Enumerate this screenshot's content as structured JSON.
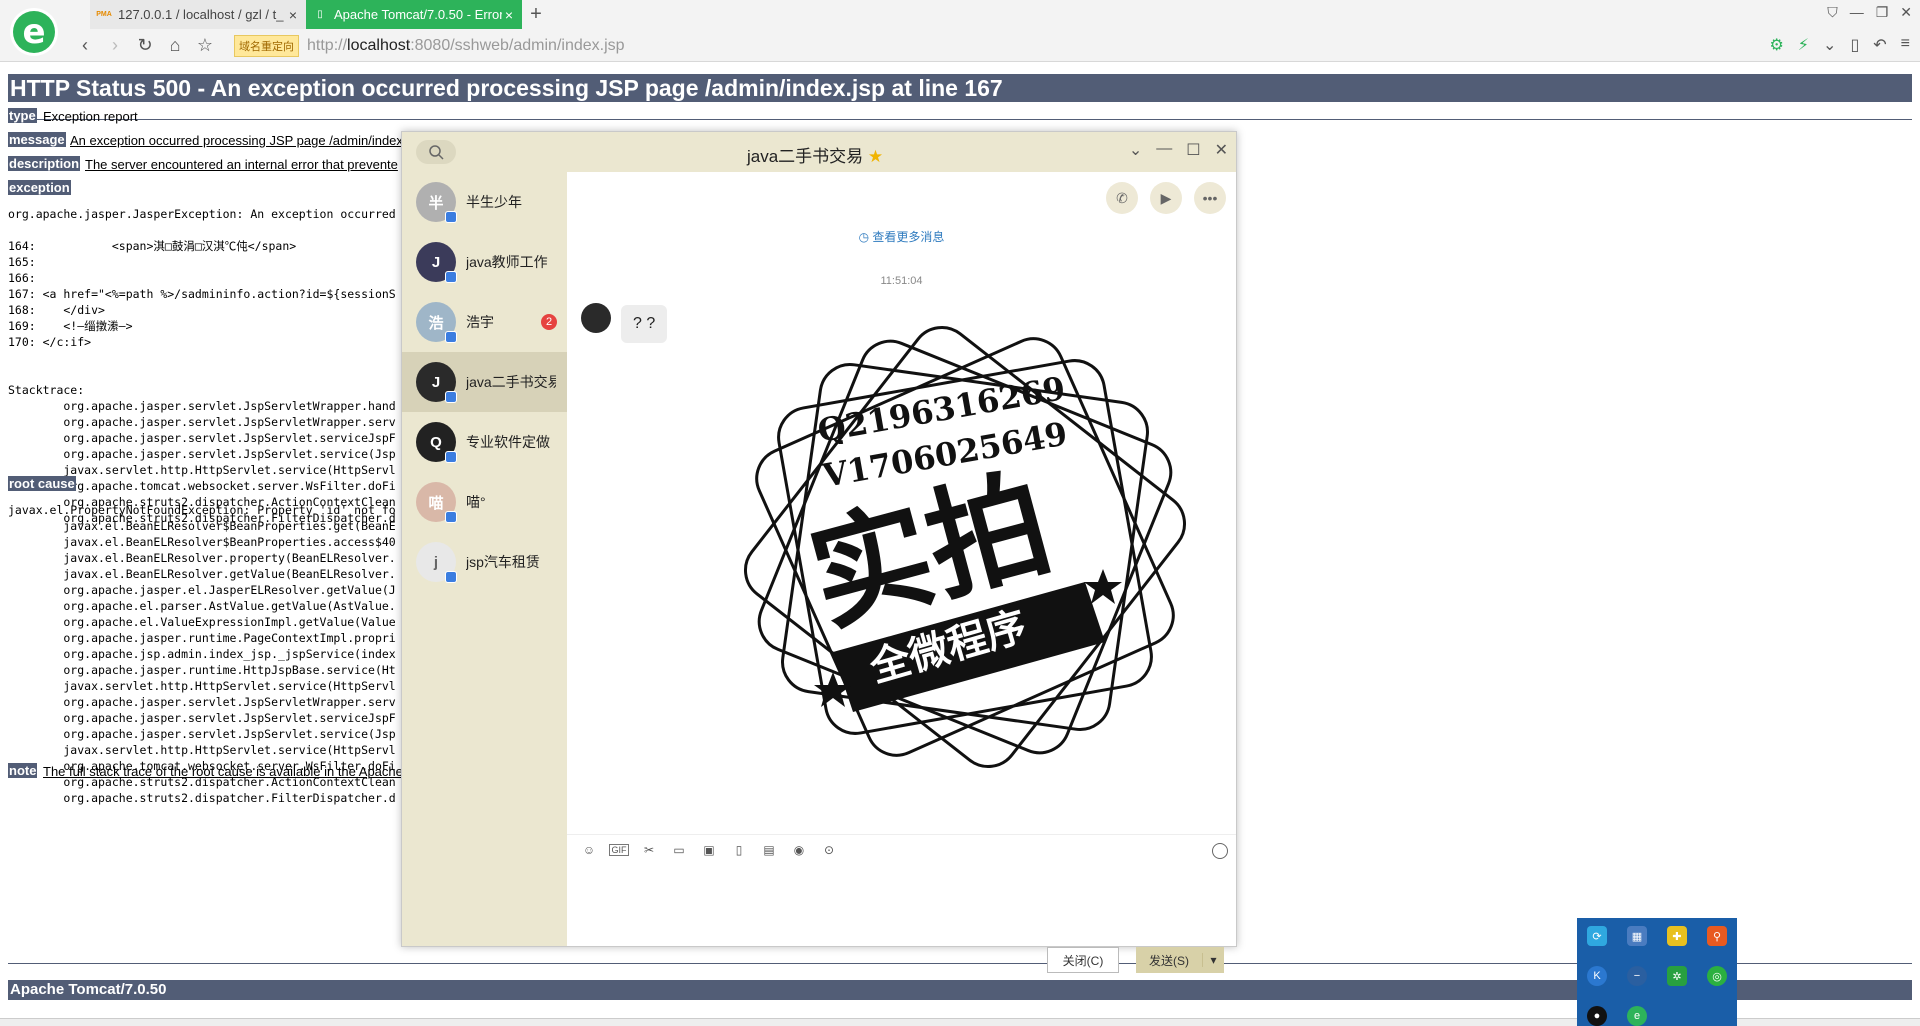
{
  "browser": {
    "tabs": [
      {
        "icon": "PMA",
        "title": "127.0.0.1 / localhost / gzl / t_"
      },
      {
        "icon": "",
        "title": "Apache Tomcat/7.0.50 - Error"
      }
    ],
    "new_tab": "+",
    "redirect_badge": "域名重定向",
    "url_prefix": "http://",
    "url_host": "localhost",
    "url_rest": ":8080/sshweb/admin/index.jsp"
  },
  "page": {
    "title": "HTTP Status 500 - An exception occurred processing JSP page /admin/index.jsp at line 167",
    "type_label": "type",
    "type_value": "Exception report",
    "message_label": "message",
    "message_value": "An exception occurred processing JSP page /admin/index.",
    "description_label": "description",
    "description_value": "The server encountered an internal error that prevente",
    "exception_label": "exception",
    "exception_text": "org.apache.jasper.JasperException: An exception occurred\n\n164:           <span>淇□鼓涓□汉淇℃伅</span>\n165:\n166:\n167: <a href=\"<%=path %>/sadmininfo.action?id=${sessionS\n168:    </div>\n169:    <!—缁撴潫—>\n170: </c:if>\n\n\nStacktrace:\n        org.apache.jasper.servlet.JspServletWrapper.hand\n        org.apache.jasper.servlet.JspServletWrapper.serv\n        org.apache.jasper.servlet.JspServlet.serviceJspF\n        org.apache.jasper.servlet.JspServlet.service(Jsp\n        javax.servlet.http.HttpServlet.service(HttpServl\n        org.apache.tomcat.websocket.server.WsFilter.doFi\n        org.apache.struts2.dispatcher.ActionContextClean\n        org.apache.struts2.dispatcher.FilterDispatcher.d",
    "root_cause_label": "root cause",
    "root_cause_text": "javax.el.PropertyNotFoundException: Property 'id' not fo\n        javax.el.BeanELResolver$BeanProperties.get(BeanE\n        javax.el.BeanELResolver$BeanProperties.access$40\n        javax.el.BeanELResolver.property(BeanELResolver.\n        javax.el.BeanELResolver.getValue(BeanELResolver.\n        org.apache.jasper.el.JasperELResolver.getValue(J\n        org.apache.el.parser.AstValue.getValue(AstValue.\n        org.apache.el.ValueExpressionImpl.getValue(Value\n        org.apache.jasper.runtime.PageContextImpl.propri\n        org.apache.jsp.admin.index_jsp._jspService(index\n        org.apache.jasper.runtime.HttpJspBase.service(Ht\n        javax.servlet.http.HttpServlet.service(HttpServl\n        org.apache.jasper.servlet.JspServletWrapper.serv\n        org.apache.jasper.servlet.JspServlet.serviceJspF\n        org.apache.jasper.servlet.JspServlet.service(Jsp\n        javax.servlet.http.HttpServlet.service(HttpServl\n        org.apache.tomcat.websocket.server.WsFilter.doFi\n        org.apache.struts2.dispatcher.ActionContextClean\n        org.apache.struts2.dispatcher.FilterDispatcher.d",
    "note_label": "note",
    "note_value": "The full stack trace of the root cause is available in the Apache",
    "footer": "Apache Tomcat/7.0.50"
  },
  "chat": {
    "title": "java二手书交易",
    "title_star": "★",
    "contacts": [
      {
        "name": "半生少年",
        "color": "#b0b0b0",
        "initial": "半",
        "badge": ""
      },
      {
        "name": "java教师工作",
        "color": "#3b3b5a",
        "initial": "J",
        "badge": ""
      },
      {
        "name": "浩宇",
        "color": "#9fb6c8",
        "initial": "浩",
        "badge": "2"
      },
      {
        "name": "java二手书交易",
        "color": "#2a2a2a",
        "initial": "J",
        "badge": ""
      },
      {
        "name": "专业软件定做",
        "color": "#222222",
        "initial": "Q",
        "badge": ""
      },
      {
        "name": "喵°",
        "color": "#d9b8a8",
        "initial": "喵",
        "badge": ""
      },
      {
        "name": "jsp汽车租赁",
        "color": "#e8e8e8",
        "initial": "j",
        "badge": ""
      }
    ],
    "active_contact": 3,
    "more_messages": "查看更多消息",
    "timestamp": "11:51:04",
    "message": "? ?",
    "stamp": {
      "line1": "Q2196316269",
      "line2": "V1706025649",
      "main": "实拍",
      "ribbon": "全微程序"
    },
    "close_button": "关闭(C)",
    "send_button": "发送(S)",
    "send_dropdown": "▾"
  }
}
